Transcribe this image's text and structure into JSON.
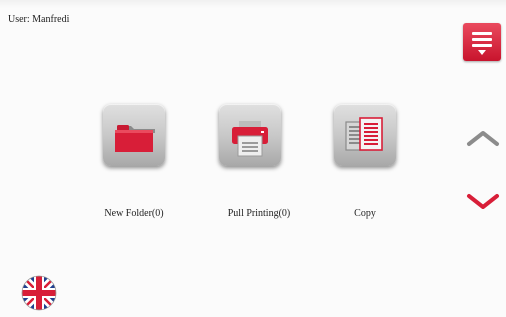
{
  "header": {
    "user_label": "User: Manfredi"
  },
  "menu": {
    "icon": "menu-icon",
    "color": "#d81e38"
  },
  "tiles": [
    {
      "label": "New Folder(0)",
      "icon": "folder-icon"
    },
    {
      "label": "Pull Printing(0)",
      "icon": "printer-icon"
    },
    {
      "label": "Copy",
      "icon": "copy-icon"
    }
  ],
  "navigation": {
    "up_icon": "chevron-up-icon",
    "down_icon": "chevron-down-icon"
  },
  "language": {
    "icon": "uk-flag-icon"
  },
  "colors": {
    "accent": "#d81e38",
    "tile": "#c4c4c4",
    "background": "#fbfbfb"
  }
}
